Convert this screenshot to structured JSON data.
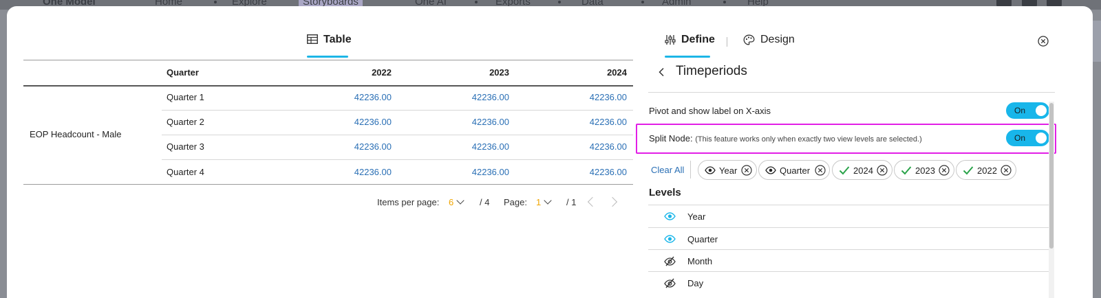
{
  "background_nav": {
    "brand": "One Model",
    "items": [
      "Home",
      "Explore",
      "Storyboards",
      "One AI",
      "Exports",
      "Data",
      "Admin",
      "Help"
    ]
  },
  "left_panel": {
    "tab_label": "Table",
    "table": {
      "headers": [
        "Quarter",
        "2022",
        "2023",
        "2024"
      ],
      "row_label": "EOP Headcount - Male",
      "rows": [
        {
          "quarter": "Quarter 1",
          "values": [
            "42236.00",
            "42236.00",
            "42236.00"
          ]
        },
        {
          "quarter": "Quarter 2",
          "values": [
            "42236.00",
            "42236.00",
            "42236.00"
          ]
        },
        {
          "quarter": "Quarter 3",
          "values": [
            "42236.00",
            "42236.00",
            "42236.00"
          ]
        },
        {
          "quarter": "Quarter 4",
          "values": [
            "42236.00",
            "42236.00",
            "42236.00"
          ]
        }
      ]
    },
    "pagination": {
      "items_label": "Items per page:",
      "items_value": "6",
      "items_total": "/ 4",
      "page_label": "Page:",
      "page_value": "1",
      "page_total": "/ 1"
    }
  },
  "right_panel": {
    "tabs": {
      "define": "Define",
      "design": "Design"
    },
    "title": "Timeperiods",
    "settings": [
      {
        "label": "Pivot and show label on X-axis",
        "note": "",
        "toggle": "On"
      },
      {
        "label": "Split Node:",
        "note": "(This feature works only when exactly two view levels are selected.)",
        "toggle": "On"
      }
    ],
    "clear_all": "Clear All",
    "chips": [
      "Year",
      "Quarter",
      "2024",
      "2023",
      "2022"
    ],
    "levels_title": "Levels",
    "levels": [
      {
        "label": "Year",
        "visible": true
      },
      {
        "label": "Quarter",
        "visible": true
      },
      {
        "label": "Month",
        "visible": false
      },
      {
        "label": "Day",
        "visible": false
      }
    ]
  },
  "colors": {
    "accent": "#1cb6e6",
    "link": "#2a6fb5",
    "highlight": "#e21ee6",
    "page_number": "#f0a500"
  }
}
